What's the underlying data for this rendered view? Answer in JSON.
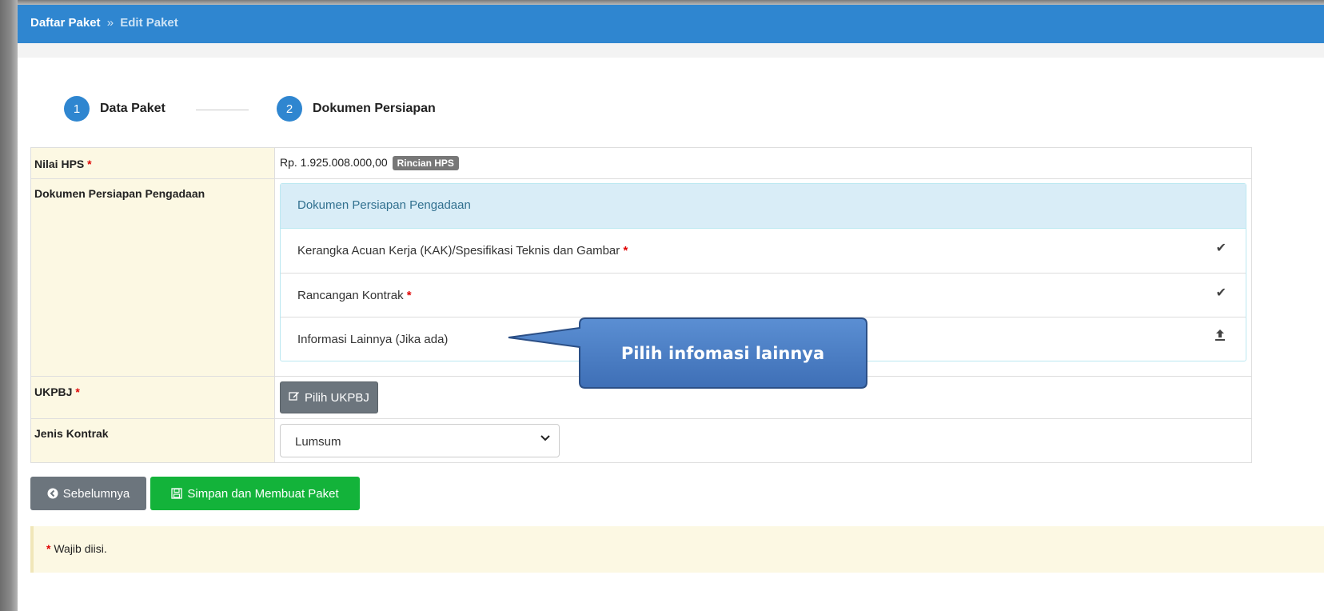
{
  "breadcrumb": {
    "root": "Daftar Paket",
    "separator": "»",
    "current": "Edit Paket"
  },
  "stepper": [
    {
      "number": "1",
      "label": "Data Paket"
    },
    {
      "number": "2",
      "label": "Dokumen Persiapan"
    }
  ],
  "form": {
    "required_mark": "*",
    "hps": {
      "label": "Nilai HPS",
      "value": "Rp. 1.925.008.000,00",
      "badge": "Rincian HPS"
    },
    "dokumen": {
      "label": "Dokumen Persiapan Pengadaan",
      "panel_title": "Dokumen Persiapan Pengadaan",
      "items": [
        {
          "label": "Kerangka Acuan Kerja (KAK)/Spesifikasi Teknis dan Gambar",
          "required": true,
          "action_icon": "check-icon"
        },
        {
          "label": "Rancangan Kontrak",
          "required": true,
          "action_icon": "check-icon"
        },
        {
          "label": "Informasi Lainnya (Jika ada)",
          "required": false,
          "action_icon": "upload-icon"
        }
      ]
    },
    "ukpbj": {
      "label": "UKPBJ",
      "button": "Pilih UKPBJ"
    },
    "jenis_kontrak": {
      "label": "Jenis Kontrak",
      "selected": "Lumsum"
    }
  },
  "actions": {
    "prev": "Sebelumnya",
    "save": "Simpan dan Membuat Paket"
  },
  "note": {
    "mark": "*",
    "text": "Wajib diisi."
  },
  "callout": {
    "text": "Pilih infomasi lainnya"
  },
  "colors": {
    "primary": "#2f86d0",
    "success": "#13b33a",
    "secondary": "#6c757d",
    "required": "#e00000",
    "callout": "#4a7bc0"
  }
}
